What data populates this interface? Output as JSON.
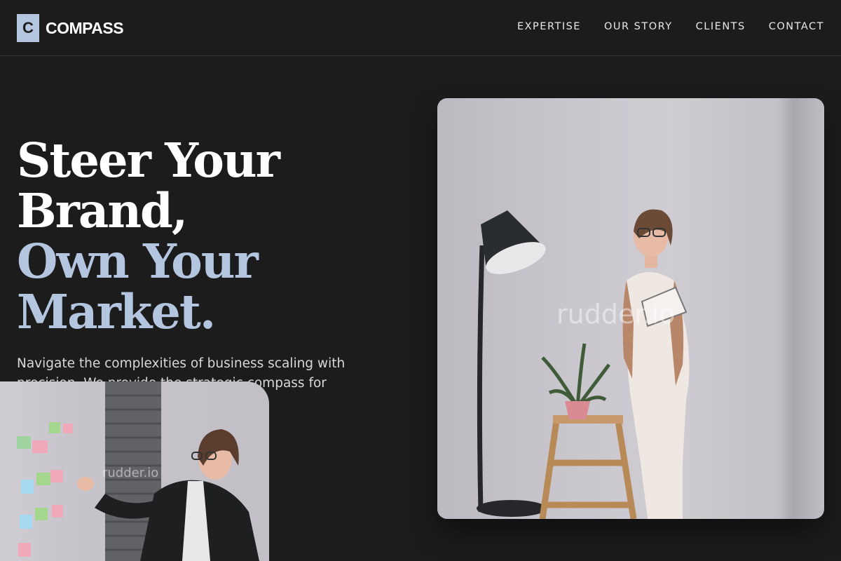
{
  "brand": {
    "mark": "C",
    "name": "COMPASS"
  },
  "nav": {
    "items": [
      {
        "label": "EXPERTISE"
      },
      {
        "label": "OUR STORY"
      },
      {
        "label": "CLIENTS"
      },
      {
        "label": "CONTACT"
      }
    ]
  },
  "hero": {
    "title_lines": [
      "Steer Your",
      "Brand,"
    ],
    "accent_lines": [
      "Own Your",
      "Market."
    ],
    "description": "Navigate the complexities of business scaling with precision. We provide the strategic compass for growth in your industry."
  },
  "images": {
    "main": {
      "watermark": "rudder.io"
    },
    "secondary": {
      "watermark": "rudder.io"
    }
  },
  "colors": {
    "background": "#1c1c1d",
    "accent": "#b3c5df",
    "text": "#ffffff"
  }
}
